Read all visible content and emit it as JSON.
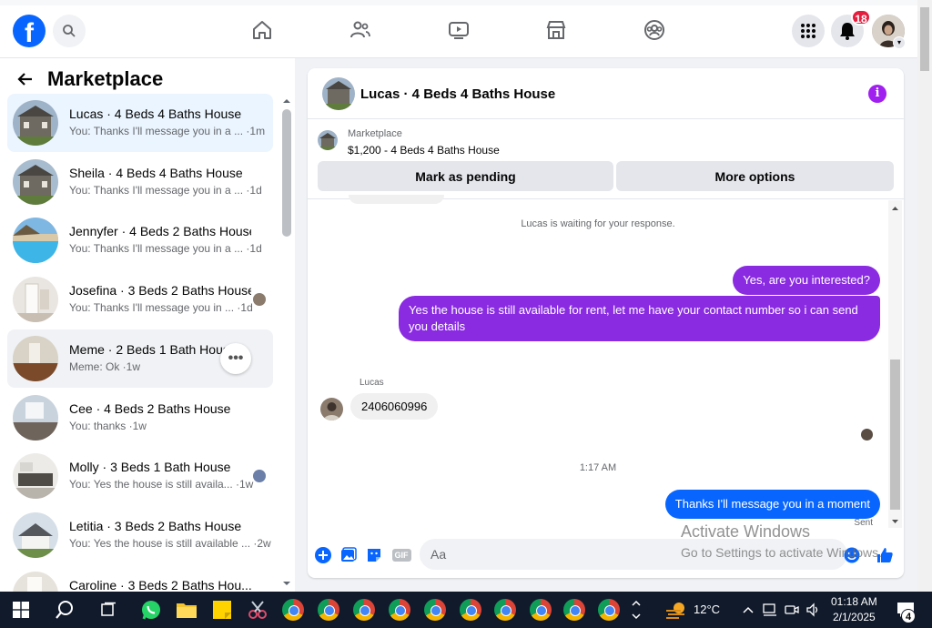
{
  "topbar": {
    "logo": "f",
    "notification_count": "18",
    "icons": [
      "search-icon",
      "home-icon",
      "friends-icon",
      "video-icon",
      "marketplace-icon",
      "groups-icon",
      "menu-grid-icon",
      "bell-icon"
    ]
  },
  "sidebar": {
    "title": "Marketplace",
    "conversations": [
      {
        "title": "Lucas · 4 Beds 4 Baths House",
        "snippet": "You: Thanks I'll message you in a ... ·1m",
        "active": true
      },
      {
        "title": "Sheila · 4 Beds 4 Baths House",
        "snippet": "You: Thanks I'll message you in a ... ·1d"
      },
      {
        "title": "Jennyfer · 4 Beds 2 Baths House",
        "snippet": "You: Thanks I'll message you in a ... ·1d"
      },
      {
        "title": "Josefina · 3 Beds 2 Baths House",
        "snippet": "You: Thanks I'll message you in ... ·1d"
      },
      {
        "title": "Meme · 2 Beds 1 Bath House",
        "snippet": "Meme: Ok ·1w",
        "hover": true
      },
      {
        "title": "Cee · 4 Beds 2 Baths House",
        "snippet": "You: thanks ·1w"
      },
      {
        "title": "Molly · 3 Beds 1 Bath House",
        "snippet": "You: Yes the house is still availa... ·1w"
      },
      {
        "title": "Letitia · 3 Beds 2 Baths House",
        "snippet": "You: Yes the house is still available ... ·2w"
      },
      {
        "title": "Caroline · 3 Beds 2 Baths Hou...",
        "snippet": ""
      }
    ],
    "more_button": "•••"
  },
  "chat": {
    "name": "Lucas · 4 Beds 4 Baths House",
    "info": "i",
    "listing_source": "Marketplace",
    "listing_price": "$1,200 - 4 Beds 4 Baths House",
    "mark_pending": "Mark as pending",
    "more_options": "More options",
    "waiting": "Lucas is waiting for your response.",
    "messages": {
      "out1": "Yes, are you interested?",
      "out2": "Yes the house is still available for rent, let me have your contact number so i can send you details",
      "sender": "Lucas",
      "in1": "2406060996",
      "time": "1:17 AM",
      "out3": "Thanks I'll message you in a moment",
      "status": "Sent"
    },
    "composer_placeholder": "Aa",
    "gif_label": "GIF"
  },
  "watermark": {
    "line1": "Activate Windows",
    "line2": "Go to Settings to activate Windows."
  },
  "taskbar": {
    "temperature": "12°C",
    "time": "01:18 AM",
    "date": "2/1/2025",
    "notifications": "4"
  }
}
